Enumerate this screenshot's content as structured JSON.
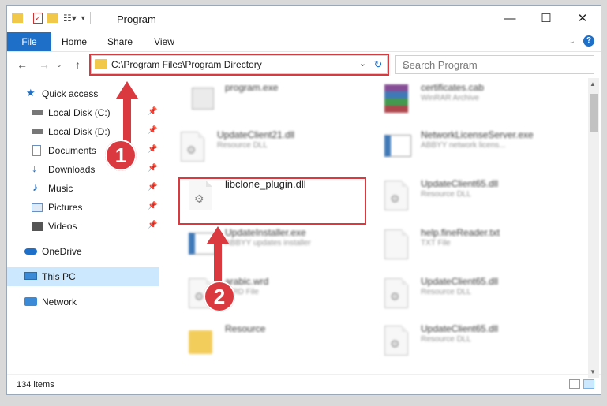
{
  "window": {
    "title": "Program",
    "controls": {
      "minimize": "—",
      "maximize": "☐",
      "close": "✕"
    }
  },
  "ribbon": {
    "tabs": [
      "File",
      "Home",
      "Share",
      "View"
    ],
    "help": "?"
  },
  "address": {
    "path": "C:\\Program Files\\Program Directory",
    "search_placeholder": "Search Program"
  },
  "sidebar": {
    "quick_access": "Quick access",
    "pinned": [
      {
        "label": "Local Disk (C:)",
        "icon": "drive-icon"
      },
      {
        "label": "Local Disk (D:)",
        "icon": "drive-icon"
      },
      {
        "label": "Documents",
        "icon": "documents-icon"
      },
      {
        "label": "Downloads",
        "icon": "downloads-icon"
      },
      {
        "label": "Music",
        "icon": "music-icon"
      },
      {
        "label": "Pictures",
        "icon": "pictures-icon"
      },
      {
        "label": "Videos",
        "icon": "videos-icon"
      }
    ],
    "onedrive": "OneDrive",
    "this_pc": "This PC",
    "network": "Network"
  },
  "files": [
    {
      "name": "program.exe",
      "type": ""
    },
    {
      "name": "certificates.cab",
      "type": "WinRAR Archive"
    },
    {
      "name": "UpdateClient21.dll",
      "type": "Resource DLL"
    },
    {
      "name": "NetworkLicenseServer.exe",
      "type": "ABBYY network licens..."
    },
    {
      "name": "libclone_plugin.dll",
      "type": ""
    },
    {
      "name": "UpdateClient65.dll",
      "type": "Resource DLL"
    },
    {
      "name": "UpdateInstaller.exe",
      "type": "ABBYY updates installer"
    },
    {
      "name": "help.fineReader.txt",
      "type": "TXT File"
    },
    {
      "name": "arabic.wrd",
      "type": "WRD File"
    },
    {
      "name": "UpdateClient65.dll",
      "type": "Resource DLL"
    },
    {
      "name": "Resource",
      "type": ""
    },
    {
      "name": "UpdateClient65.dll",
      "type": "Resource DLL"
    }
  ],
  "status": {
    "item_count": "134 items"
  },
  "annotations": {
    "step1": "1",
    "step2": "2"
  },
  "colors": {
    "accent": "#1e6fc8",
    "highlight": "#d9393f",
    "selection": "#cce8ff"
  }
}
